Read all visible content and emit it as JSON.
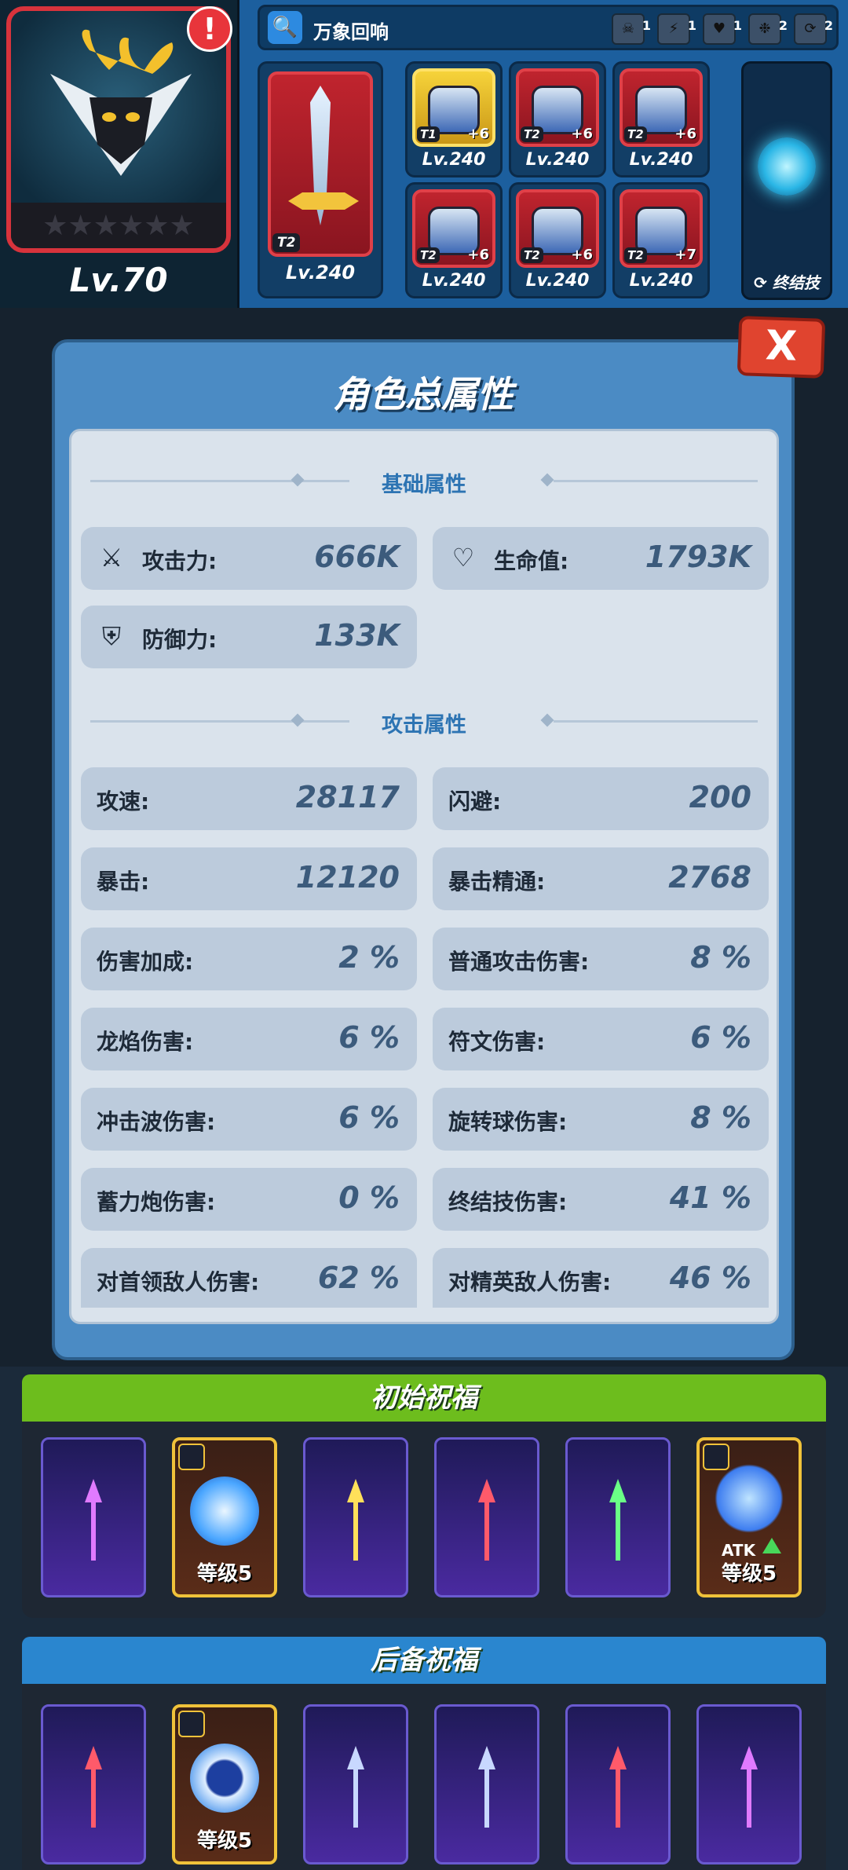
{
  "hero": {
    "level_label": "Lv.70",
    "alert": "!",
    "stars": "★★★★★★"
  },
  "set_bar": {
    "title": "万象回响",
    "slots": [
      {
        "icon": "skull-icon",
        "count": "1"
      },
      {
        "icon": "lightning-icon",
        "count": "1"
      },
      {
        "icon": "heart-icon",
        "count": "1"
      },
      {
        "icon": "gear-icon",
        "count": "2"
      },
      {
        "icon": "swirl-icon",
        "count": "2"
      }
    ]
  },
  "weapon": {
    "tier": "T2",
    "level": "Lv.240"
  },
  "gear": [
    {
      "tier": "T1",
      "plus": "+6",
      "level": "Lv.240"
    },
    {
      "tier": "T2",
      "plus": "+6",
      "level": "Lv.240"
    },
    {
      "tier": "T2",
      "plus": "+6",
      "level": "Lv.240"
    },
    {
      "tier": "T2",
      "plus": "+6",
      "level": "Lv.240"
    },
    {
      "tier": "T2",
      "plus": "+6",
      "level": "Lv.240"
    },
    {
      "tier": "T2",
      "plus": "+7",
      "level": "Lv.240"
    }
  ],
  "skill": {
    "label": "终结技"
  },
  "modal": {
    "title": "角色总属性",
    "close": "X",
    "basic_header": "基础属性",
    "attack_header": "攻击属性",
    "basic": [
      {
        "name": "攻击力:",
        "value": "666K",
        "icon": "sword-icon"
      },
      {
        "name": "生命值:",
        "value": "1793K",
        "icon": "heart-icon"
      },
      {
        "name": "防御力:",
        "value": "133K",
        "icon": "shield-icon"
      }
    ],
    "attack": [
      {
        "name": "攻速:",
        "value": "28117"
      },
      {
        "name": "闪避:",
        "value": "200"
      },
      {
        "name": "暴击:",
        "value": "12120"
      },
      {
        "name": "暴击精通:",
        "value": "2768"
      },
      {
        "name": "伤害加成:",
        "value": "2 %"
      },
      {
        "name": "普通攻击伤害:",
        "value": "8 %"
      },
      {
        "name": "龙焰伤害:",
        "value": "6 %"
      },
      {
        "name": "符文伤害:",
        "value": "6 %"
      },
      {
        "name": "冲击波伤害:",
        "value": "6 %"
      },
      {
        "name": "旋转球伤害:",
        "value": "8 %"
      },
      {
        "name": "蓄力炮伤害:",
        "value": "0 %"
      },
      {
        "name": "终结技伤害:",
        "value": "41 %"
      },
      {
        "name": "对首领敌人伤害:",
        "value": "62 %"
      },
      {
        "name": "对精英敌人伤害:",
        "value": "46 %"
      }
    ]
  },
  "initial_blessing": {
    "title": "初始祝福",
    "header_color": "#6dbd1d",
    "cards": [
      {
        "type": "arrow",
        "color": "#e07aff"
      },
      {
        "type": "skill",
        "label": "等级5"
      },
      {
        "type": "arrow",
        "color": "#ffe05a"
      },
      {
        "type": "arrow",
        "color": "#ff5a6a"
      },
      {
        "type": "arrow",
        "color": "#6aff86"
      },
      {
        "type": "skill",
        "label": "等级5",
        "atk": "ATK"
      }
    ]
  },
  "reserve_blessing": {
    "title": "后备祝福",
    "header_color": "#2a86cf",
    "cards": [
      {
        "type": "arrow",
        "color": "#ff5a6a"
      },
      {
        "type": "skill",
        "label": "等级5"
      },
      {
        "type": "arrow",
        "color": "#c8d8ff"
      },
      {
        "type": "arrow",
        "color": "#c8d8ff"
      },
      {
        "type": "arrow",
        "color": "#ff5a6a"
      },
      {
        "type": "arrow",
        "color": "#e07aff"
      }
    ]
  }
}
